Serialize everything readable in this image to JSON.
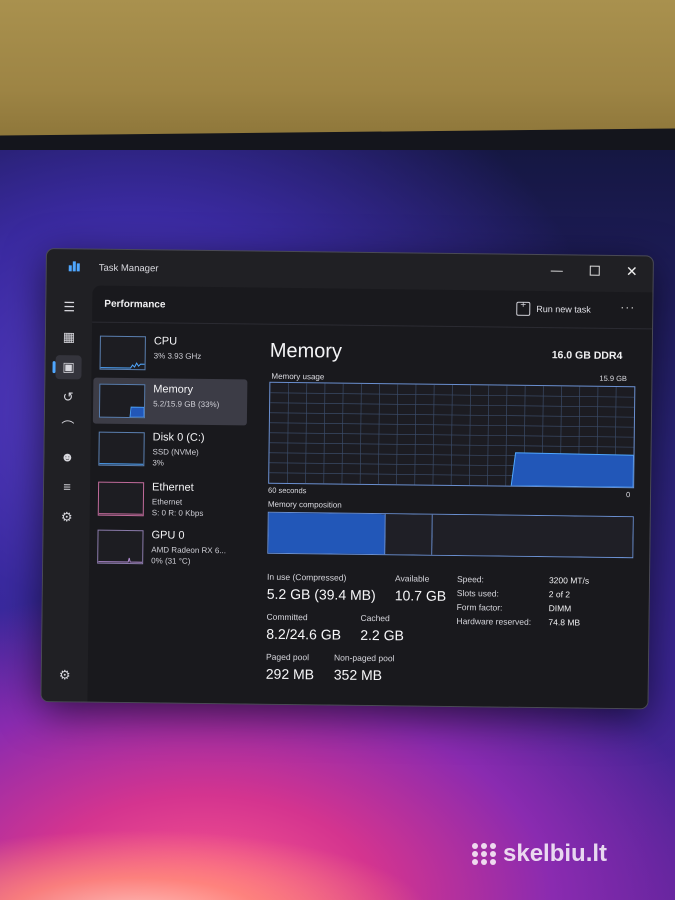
{
  "window": {
    "title": "Task Manager",
    "minimize_glyph": "—",
    "close_glyph": "✕"
  },
  "header": {
    "section": "Performance",
    "run_new_task": "Run new task",
    "more": "···"
  },
  "nav": [
    {
      "icon": "hamburger-menu-icon",
      "glyph": "☰"
    },
    {
      "icon": "processes-icon",
      "glyph": "▦"
    },
    {
      "icon": "performance-icon",
      "glyph": "▣",
      "active": true
    },
    {
      "icon": "app-history-icon",
      "glyph": "↺"
    },
    {
      "icon": "startup-apps-icon",
      "glyph": "⌒"
    },
    {
      "icon": "users-icon",
      "glyph": "☻"
    },
    {
      "icon": "details-icon",
      "glyph": "≡"
    },
    {
      "icon": "services-icon",
      "glyph": "⚙"
    },
    {
      "icon": "settings-icon",
      "glyph": "⚙"
    }
  ],
  "devices": [
    {
      "name": "CPU",
      "line1": "3% 3.93 GHz",
      "line2": ""
    },
    {
      "name": "Memory",
      "line1": "5.2/15.9 GB (33%)",
      "line2": "",
      "selected": true
    },
    {
      "name": "Disk 0 (C:)",
      "line1": "SSD (NVMe)",
      "line2": "3%"
    },
    {
      "name": "Ethernet",
      "line1": "Ethernet",
      "line2": "S: 0 R: 0 Kbps"
    },
    {
      "name": "GPU 0",
      "line1": "AMD Radeon RX 6...",
      "line2": "0% (31 °C)"
    }
  ],
  "memory": {
    "title": "Memory",
    "spec": "16.0 GB DDR4",
    "usage_label": "Memory usage",
    "usage_max": "15.9 GB",
    "axis_left": "60 seconds",
    "axis_right": "0",
    "composition_label": "Memory composition",
    "usage_fraction": 0.33,
    "stats": {
      "in_use_label": "In use (Compressed)",
      "in_use_value": "5.2 GB (39.4 MB)",
      "available_label": "Available",
      "available_value": "10.7 GB",
      "committed_label": "Committed",
      "committed_value": "8.2/24.6 GB",
      "cached_label": "Cached",
      "cached_value": "2.2 GB",
      "paged_label": "Paged pool",
      "paged_value": "292 MB",
      "nonpaged_label": "Non-paged pool",
      "nonpaged_value": "352 MB"
    },
    "specs": {
      "speed_label": "Speed:",
      "speed_value": "3200 MT/s",
      "slots_label": "Slots used:",
      "slots_value": "2 of 2",
      "form_label": "Form factor:",
      "form_value": "DIMM",
      "hw_label": "Hardware reserved:",
      "hw_value": "74.8 MB"
    }
  },
  "watermark": "skelbiu.lt",
  "colors": {
    "accent": "#4fa7ff",
    "memory_fill": "#2257b8",
    "chart_border": "#6a8fd0"
  }
}
